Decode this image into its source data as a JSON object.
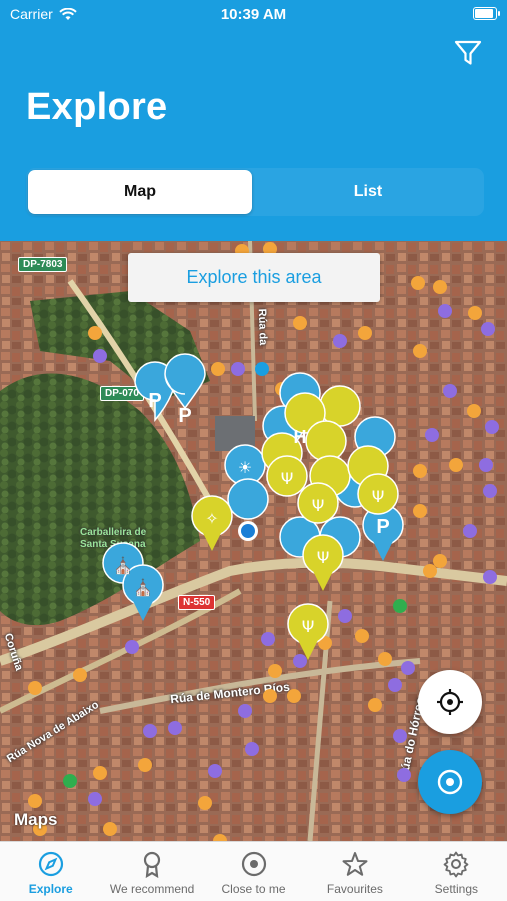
{
  "status": {
    "carrier": "Carrier",
    "time": "10:39 AM"
  },
  "header": {
    "title": "Explore",
    "filter_icon": "filter-icon"
  },
  "segment": {
    "map_label": "Map",
    "list_label": "List",
    "selected": "Map"
  },
  "map": {
    "explore_button": "Explore this area",
    "road_signs": [
      "DP-7803",
      "DP-070",
      "N-550"
    ],
    "labels": [
      "Carballeira de Santa Susana",
      "Rúa de Montero Ríos",
      "Rúa do Hórreo",
      "Rúa da",
      "Rúa Nova de Abaixo",
      "Coruña"
    ],
    "attribution": "Maps"
  },
  "fabs": {
    "locate_icon": "crosshair-icon",
    "nearby_icon": "target-icon"
  },
  "tabs": [
    {
      "label": "Explore",
      "icon": "compass-icon",
      "active": true
    },
    {
      "label": "We recommend",
      "icon": "award-icon",
      "active": false
    },
    {
      "label": "Close to me",
      "icon": "target-icon",
      "active": false
    },
    {
      "label": "Favourites",
      "icon": "star-icon",
      "active": false
    },
    {
      "label": "Settings",
      "icon": "gear-icon",
      "active": false
    }
  ],
  "colors": {
    "brand": "#1a9ee0",
    "pin_blue": "#3aa7dc",
    "pin_yellow": "#d8d32a"
  }
}
